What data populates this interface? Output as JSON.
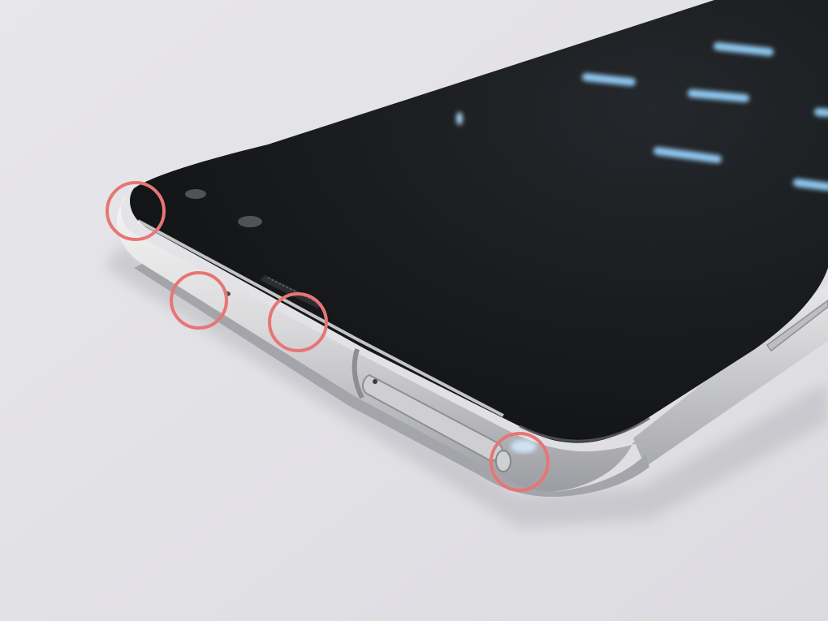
{
  "photo": {
    "subject": "smartphone-top-edge-closeup",
    "colors": {
      "background": "#e4e3e8",
      "screen": "#17191b",
      "frame_silver": "#d8d8da",
      "frame_highlight": "#f4f4f2",
      "frame_shadow": "#9b9ca0",
      "screen_light_streak": "#8ec8f0",
      "annotation_circle": "#e87575"
    },
    "annotations": {
      "count": 4,
      "shape": "circle",
      "marked_features": [
        "top-left-corner",
        "microphone-hole",
        "earpiece-edge",
        "top-right-corner"
      ]
    }
  }
}
